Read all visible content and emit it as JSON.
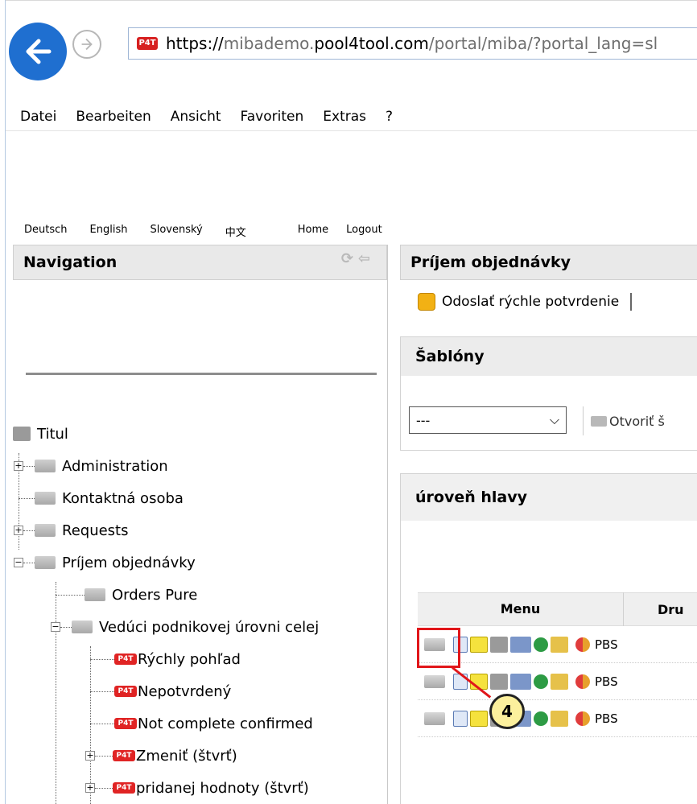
{
  "browser": {
    "url_scheme": "https://",
    "url_host_pre": "mibademo.",
    "url_host": "pool4tool.com",
    "url_path": "/portal/miba/?portal_lang=sl",
    "site_badge": "P4T"
  },
  "menubar": [
    "Datei",
    "Bearbeiten",
    "Ansicht",
    "Favoriten",
    "Extras",
    "?"
  ],
  "lang": {
    "items": [
      "Deutsch",
      "English",
      "Slovenský",
      "中文"
    ],
    "home": "Home",
    "logout": "Logout"
  },
  "nav": {
    "title": "Navigation",
    "tree": {
      "root": "Titul",
      "administration": "Administration",
      "kontakt": "Kontaktná osoba",
      "requests": "Requests",
      "prijem": "Príjem objednávky",
      "orders_pure": "Orders Pure",
      "veduci": "Vedúci podnikovej úrovni celej",
      "rychly": "Rýchly pohľad",
      "nepotvrdeny": "Nepotvrdený",
      "not_complete": "Not complete confirmed",
      "zmenit": "Zmeniť (štvrť)",
      "pridanej": "pridanej hodnoty (štvrť)"
    }
  },
  "content": {
    "title": "Príjem objednávky",
    "quick_confirm": "Odoslať rýchle potvrdenie",
    "templates_title": "Šablóny",
    "select_value": "---",
    "open_label": "Otvoriť š",
    "head_level_title": "úroveň hlavy",
    "table": {
      "col_menu": "Menu",
      "col_dru": "Dru",
      "rows": [
        "PBS",
        "PBS",
        "PBS"
      ]
    }
  },
  "callout": {
    "number": "4"
  },
  "colors": {
    "accent": "#1f6fd0",
    "highlight": "#e1161a",
    "callout_fill": "#fcf09d"
  }
}
